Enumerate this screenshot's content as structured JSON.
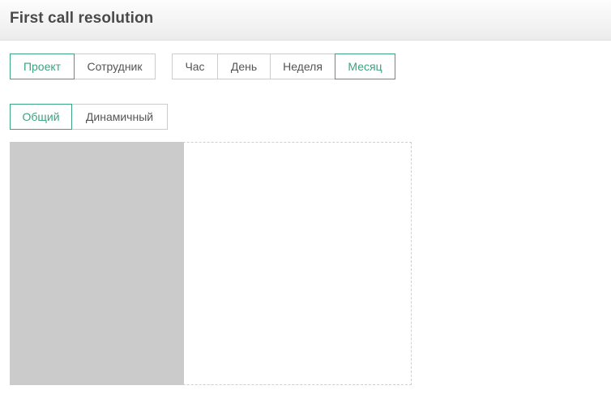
{
  "header": {
    "title": "First call resolution"
  },
  "scope_filter": {
    "options": [
      {
        "label": "Проект",
        "active": true
      },
      {
        "label": "Сотрудник",
        "active": false
      }
    ]
  },
  "period_filter": {
    "options": [
      {
        "label": "Час",
        "active": false
      },
      {
        "label": "День",
        "active": false
      },
      {
        "label": "Неделя",
        "active": false
      },
      {
        "label": "Месяц",
        "active": true
      }
    ]
  },
  "view_filter": {
    "options": [
      {
        "label": "Общий",
        "active": true
      },
      {
        "label": "Динамичный",
        "active": false
      }
    ]
  },
  "colors": {
    "accent": "#3aa37f",
    "border": "#cccccc",
    "placeholder": "#cbcbcb"
  }
}
